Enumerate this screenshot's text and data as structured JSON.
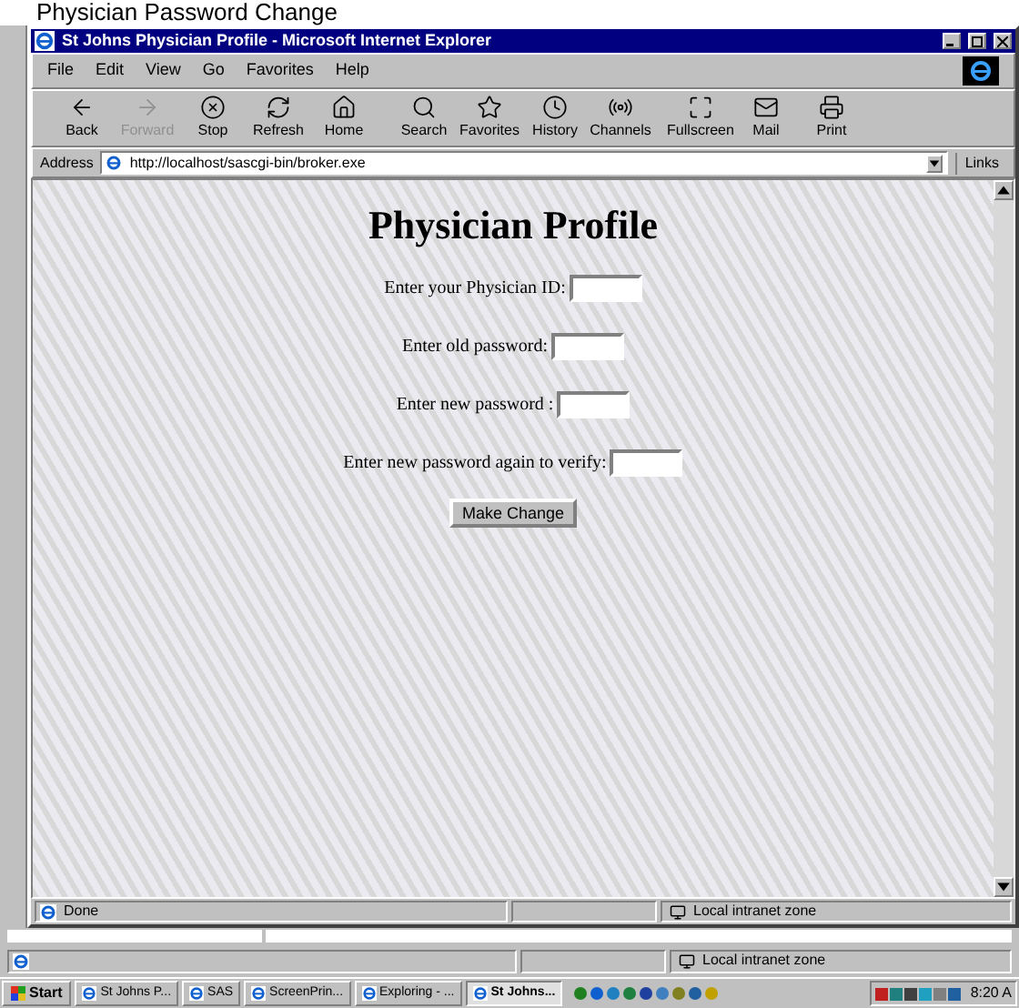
{
  "slide_title": "Physician Password Change",
  "window": {
    "title": "St Johns Physician Profile - Microsoft Internet Explorer"
  },
  "menu": [
    "File",
    "Edit",
    "View",
    "Go",
    "Favorites",
    "Help"
  ],
  "toolbar": [
    {
      "label": "Back",
      "kind": "back",
      "disabled": false
    },
    {
      "label": "Forward",
      "kind": "forward",
      "disabled": true
    },
    {
      "label": "Stop",
      "kind": "stop",
      "disabled": false
    },
    {
      "label": "Refresh",
      "kind": "refresh",
      "disabled": false
    },
    {
      "label": "Home",
      "kind": "home",
      "disabled": false
    },
    {
      "label": "Search",
      "kind": "search",
      "disabled": false
    },
    {
      "label": "Favorites",
      "kind": "favorites",
      "disabled": false
    },
    {
      "label": "History",
      "kind": "history",
      "disabled": false
    },
    {
      "label": "Channels",
      "kind": "channels",
      "disabled": false
    },
    {
      "label": "Fullscreen",
      "kind": "fullscreen",
      "disabled": false
    },
    {
      "label": "Mail",
      "kind": "mail",
      "disabled": false
    },
    {
      "label": "Print",
      "kind": "print",
      "disabled": false
    }
  ],
  "address": {
    "label": "Address",
    "value": "http://localhost/sascgi-bin/broker.exe",
    "links": "Links"
  },
  "page": {
    "heading": "Physician Profile",
    "fields": [
      {
        "label": "Enter your Physician ID:"
      },
      {
        "label": "Enter old password:"
      },
      {
        "label": "Enter new password :"
      },
      {
        "label": "Enter new password again to verify:"
      }
    ],
    "button": "Make Change"
  },
  "status_bar": {
    "text": "Done",
    "zone": "Local intranet zone"
  },
  "outer_status_bar": {
    "zone": "Local intranet zone"
  },
  "taskbar": {
    "start": "Start",
    "tasks": [
      {
        "label": "St Johns P...",
        "selected": false
      },
      {
        "label": "SAS",
        "selected": false
      },
      {
        "label": "ScreenPrin...",
        "selected": false
      },
      {
        "label": "Exploring - ...",
        "selected": false
      },
      {
        "label": "St Johns...",
        "selected": true
      }
    ],
    "clock": "8:20 A"
  }
}
